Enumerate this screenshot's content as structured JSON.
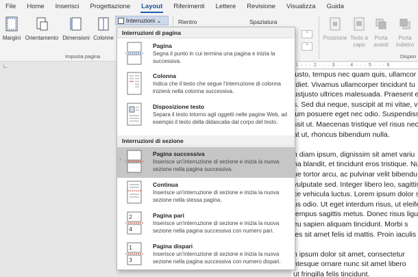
{
  "menu": {
    "tabs": [
      "File",
      "Home",
      "Inserisci",
      "Progettazione",
      "Layout",
      "Riferimenti",
      "Lettere",
      "Revisione",
      "Visualizza",
      "Guida"
    ],
    "active": "Layout"
  },
  "ribbon": {
    "margini": "Margini",
    "orientamento": "Orientamento",
    "dimensioni": "Dimensioni",
    "colonne": "Colonne",
    "imposta_pagina": "Imposta pagina",
    "interruzioni": "Interruzioni",
    "rientro": "Rientro",
    "spaziatura": "Spaziatura",
    "posizione": "Posizione",
    "testo_a": "Testo a",
    "capo": "capo",
    "porta_avanti_1": "Porta",
    "porta_avanti_2": "avanti",
    "porta_indietro_1": "Porta",
    "porta_indietro_2": "indietro",
    "disponi": "Dispon"
  },
  "dropdown": {
    "section1": "Interruzioni di pagina",
    "section2": "Interruzioni di sezione",
    "items": [
      {
        "title": "Pagina",
        "desc": "Segna il punto in cui termina una pagina e inizia la successiva."
      },
      {
        "title": "Colonna",
        "desc": "Indica che il testo che segue l'interruzione di colonna inizierà nella colonna successiva."
      },
      {
        "title": "Disposizione testo",
        "desc": "Separa il testo intorno agli oggetti nelle pagine Web, ad esempio il testo della didascalia dal corpo del testo."
      },
      {
        "title": "Pagina successiva",
        "desc": "Inserisce un'interruzione di sezione e inizia la nuova sezione nella pagina successiva."
      },
      {
        "title": "Continua",
        "desc": "Inserisce un'interruzione di sezione e inizia la nuova sezione nella stessa pagina."
      },
      {
        "title": "Pagina pari",
        "desc": "Inserisce un'interruzione di sezione e inizia la nuova sezione nella pagina successiva con numero pari."
      },
      {
        "title": "Pagina dispari",
        "desc": "Inserisce un'interruzione di sezione e inizia la nuova sezione nella pagina successiva con numero dispari."
      }
    ]
  },
  "document": {
    "ruler": "· 1 · · · 2 · · · 3 · · · 4 · · · 5 · · · 6",
    "lines": [
      "iusto, tempus nec quam quis, ullamcor",
      "rdiet. Vivamus ullamcorper tincidunt tu",
      "ustjusto ultrices malesuada. Praesent eu",
      "s. Sed dui neque, suscipit at mi vitae, vel",
      "ium posuere eget nec odio. Suspendisse",
      "ssit ut. Maecenas tristique vel risus nec",
      "at ut, rhoncus bibendum nulla.",
      "",
      "n diam ipsum, dignissim sit amet variu",
      "na blandit, et tincidunt eros tristique. Nu",
      "ue tortor arcu, ac pulvinar velit bibendu",
      "vulputate sed. Integer libero leo, sagittis",
      "ce vehicula luctus. Lorem ipsum dolor sit",
      "us odio. Ut eget interdum risus, ut eleife",
      "tempus sagittis metus. Donec risus ligula",
      "eu sapien aliquam tincidunt. Morbi s",
      "ies sit amet felis id mattis. Proin iaculis",
      "",
      "n ipsum dolor sit amet, consectetur",
      "ntesque ornare nunc sit amet libero",
      "ut fringilla felis tincidunt."
    ]
  }
}
